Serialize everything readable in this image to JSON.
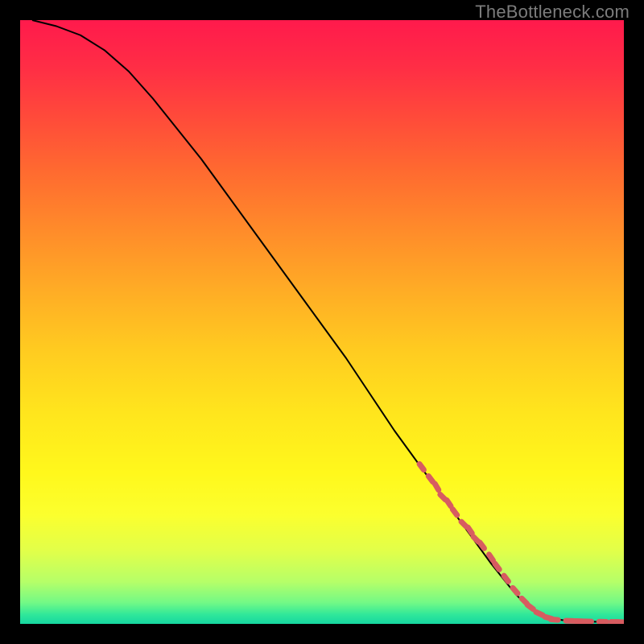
{
  "watermark": "TheBottleneck.com",
  "colors": {
    "page_bg": "#000000",
    "watermark": "#7c7c7c",
    "line": "#000000",
    "marker": "#d75c60",
    "gradient_stops": [
      {
        "offset": 0.0,
        "color": "#ff1a4c"
      },
      {
        "offset": 0.08,
        "color": "#ff2e45"
      },
      {
        "offset": 0.16,
        "color": "#ff4a3a"
      },
      {
        "offset": 0.25,
        "color": "#ff6a30"
      },
      {
        "offset": 0.35,
        "color": "#ff8c2a"
      },
      {
        "offset": 0.45,
        "color": "#ffad25"
      },
      {
        "offset": 0.55,
        "color": "#ffcc20"
      },
      {
        "offset": 0.65,
        "color": "#ffe51d"
      },
      {
        "offset": 0.75,
        "color": "#fff81c"
      },
      {
        "offset": 0.82,
        "color": "#fbff2e"
      },
      {
        "offset": 0.88,
        "color": "#e1ff4a"
      },
      {
        "offset": 0.93,
        "color": "#b6ff68"
      },
      {
        "offset": 0.965,
        "color": "#72f986"
      },
      {
        "offset": 0.985,
        "color": "#2fe79a"
      },
      {
        "offset": 1.0,
        "color": "#16d7a0"
      }
    ]
  },
  "chart_data": {
    "type": "line",
    "title": "",
    "xlabel": "",
    "ylabel": "",
    "xlim": [
      0,
      100
    ],
    "ylim": [
      0,
      100
    ],
    "series": [
      {
        "name": "curve",
        "x": [
          2,
          6,
          10,
          14,
          18,
          22,
          26,
          30,
          34,
          38,
          42,
          46,
          50,
          54,
          58,
          62,
          66,
          70,
          74,
          78,
          82,
          84,
          86,
          88,
          90,
          92,
          94,
          96,
          98,
          99
        ],
        "y": [
          100,
          99,
          97.5,
          95,
          91.5,
          87,
          82,
          77,
          71.5,
          66,
          60.5,
          55,
          49.5,
          44,
          38,
          32,
          26.5,
          21,
          15.5,
          10,
          5,
          3,
          1.6,
          0.9,
          0.6,
          0.45,
          0.38,
          0.33,
          0.3,
          0.3
        ]
      }
    ],
    "highlighted_points": {
      "name": "markers",
      "x": [
        66.5,
        68,
        69,
        70,
        71,
        72,
        73.5,
        74.5,
        75.5,
        76.5,
        78,
        79,
        80.5,
        82,
        83.5,
        84.5,
        86,
        87.5,
        88.5,
        91,
        92.5,
        94,
        96.5,
        98.5,
        99.2
      ],
      "y": [
        26,
        24,
        22.7,
        21,
        20,
        18.5,
        16.5,
        15.5,
        14,
        13,
        11,
        9.5,
        7.5,
        5.5,
        3.8,
        2.8,
        1.7,
        1.0,
        0.7,
        0.5,
        0.45,
        0.4,
        0.35,
        0.32,
        0.3
      ]
    }
  }
}
